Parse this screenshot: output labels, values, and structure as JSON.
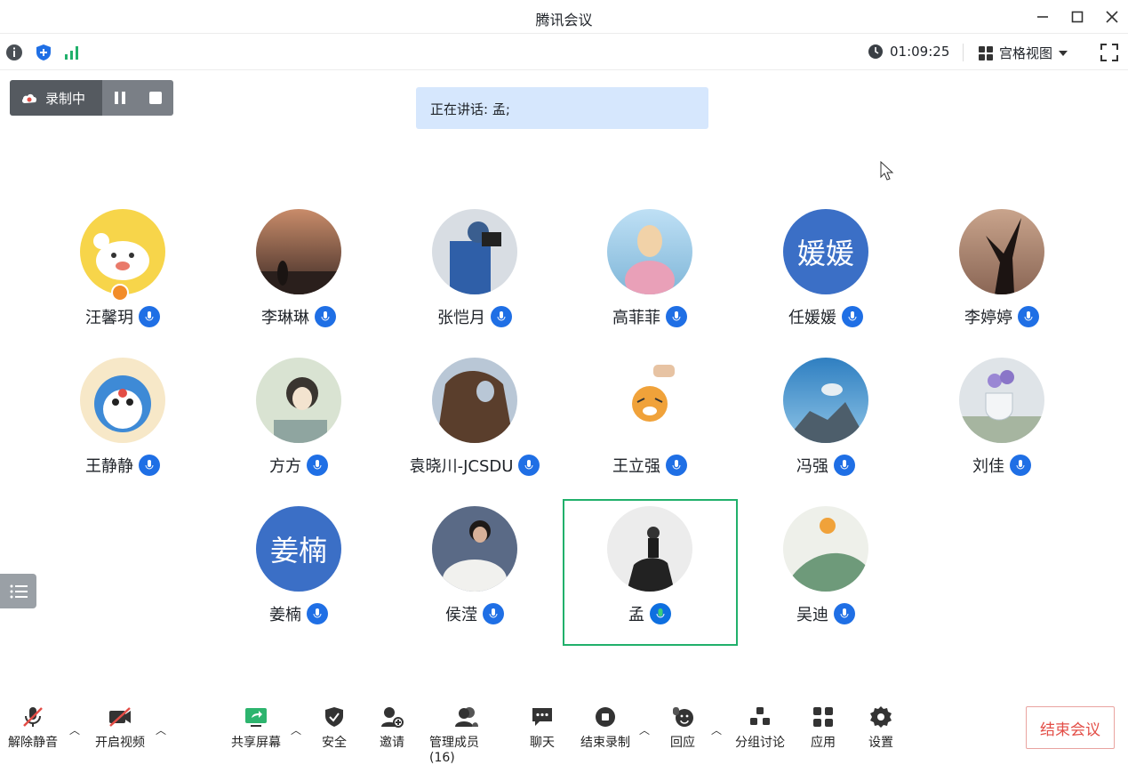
{
  "window": {
    "title": "腾讯会议"
  },
  "status": {
    "timer": "01:09:25",
    "view_mode": "宫格视图"
  },
  "recording": {
    "label": "录制中"
  },
  "speaking": {
    "text": "正在讲话: 孟;"
  },
  "participants": [
    {
      "name": "汪馨玥",
      "avatar": "cartoon",
      "mic": "muted-blue"
    },
    {
      "name": "李琳琳",
      "avatar": "photo",
      "mic": "muted-blue"
    },
    {
      "name": "张恺月",
      "avatar": "photo",
      "mic": "muted-blue"
    },
    {
      "name": "高菲菲",
      "avatar": "photo",
      "mic": "muted-blue"
    },
    {
      "name": "任媛媛",
      "avatar_text": "媛媛",
      "mic": "muted-blue"
    },
    {
      "name": "李婷婷",
      "avatar": "photo",
      "mic": "muted-blue"
    },
    {
      "name": "王静静",
      "avatar": "cartoon",
      "mic": "muted-blue"
    },
    {
      "name": "方方",
      "avatar": "illustration",
      "mic": "muted-blue"
    },
    {
      "name": "袁晓川-JCSDU",
      "avatar": "photo",
      "mic": "muted-blue"
    },
    {
      "name": "王立强",
      "avatar": "illustration",
      "mic": "muted-blue"
    },
    {
      "name": "冯强",
      "avatar": "photo",
      "mic": "muted-blue"
    },
    {
      "name": "刘佳",
      "avatar": "photo",
      "mic": "muted-blue"
    },
    {
      "name": "姜楠",
      "avatar_text": "姜楠",
      "mic": "muted-blue"
    },
    {
      "name": "侯滢",
      "avatar": "photo",
      "mic": "muted-blue"
    },
    {
      "name": "孟",
      "avatar": "photo",
      "mic": "speaking-green",
      "active": true
    },
    {
      "name": "吴迪",
      "avatar": "illustration",
      "mic": "muted-blue"
    }
  ],
  "toolbar": {
    "unmute": "解除静音",
    "video": "开启视频",
    "share": "共享屏幕",
    "security": "安全",
    "invite": "邀请",
    "members": "管理成员(16)",
    "chat": "聊天",
    "stop_record": "结束录制",
    "react": "回应",
    "breakout": "分组讨论",
    "apps": "应用",
    "settings": "设置",
    "end_meeting": "结束会议"
  },
  "colors": {
    "accent_blue": "#1f6fe5",
    "active_green": "#21b06b",
    "end_red": "#e34d46"
  }
}
